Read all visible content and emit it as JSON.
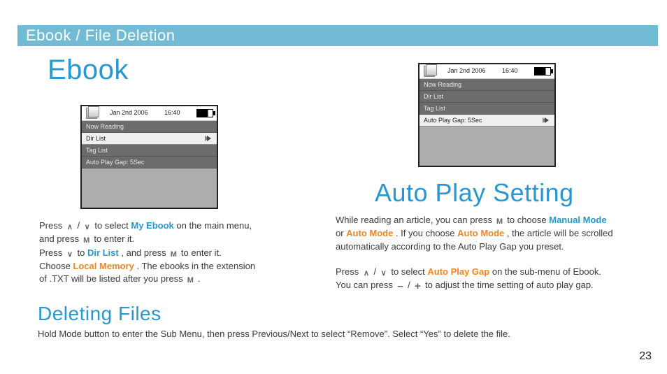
{
  "banner": {
    "title": "Ebook / File Deletion"
  },
  "headings": {
    "ebook": "Ebook",
    "autoplay": "Auto Play Setting",
    "deleting": "Deleting Files"
  },
  "device": {
    "date": "Jan 2nd 2006",
    "time": "16:40",
    "rows": {
      "now_reading": "Now Reading",
      "dir_list": "Dir List",
      "tag_list": "Tag List",
      "auto_play_gap": "Auto Play Gap: 5Sec"
    }
  },
  "left": {
    "l1a": "Press ",
    "l1b": " / ",
    "l1c": " to select ",
    "l1_myebook": "My Ebook",
    "l1d": " on the main menu,",
    "l2a": "and press ",
    "l2b": " to enter it.",
    "l3a": "Press ",
    "l3b": " to ",
    "l3_dirlist": "Dir List",
    "l3c": ", and press ",
    "l3d": " to enter it.",
    "l4a": "Choose ",
    "l4_local": "Local Memory",
    "l4b": ". The ebooks in the extension",
    "l5a": "of .TXT will be listed after you press ",
    "l5b": " ."
  },
  "right": {
    "r1a": "While reading an article, you can press ",
    "r1b": " to choose ",
    "r1_manual": "Manual Mode",
    "r2a": "or ",
    "r2_auto1": "Auto Mode",
    "r2b": ". If you choose ",
    "r2_auto2": "Auto Mode",
    "r2c": ", the article will be scrolled",
    "r3": "automatically according to the Auto Play Gap you preset.",
    "r5a": "Press ",
    "r5b": " / ",
    "r5c": " to select ",
    "r5_apg": "Auto Play Gap",
    "r5d": " on the sub-menu of Ebook.",
    "r6a": "You can press ",
    "r6b": " / ",
    "r6c": " to adjust the time setting of auto play gap."
  },
  "deleting": {
    "text": "Hold Mode button to enter the Sub Menu, then press Previous/Next to select “Remove”. Select “Yes” to delete the file."
  },
  "page_number": "23",
  "icons": {
    "up": "∧",
    "down": "∨",
    "m": "M",
    "minus": "–",
    "plus": "+"
  }
}
